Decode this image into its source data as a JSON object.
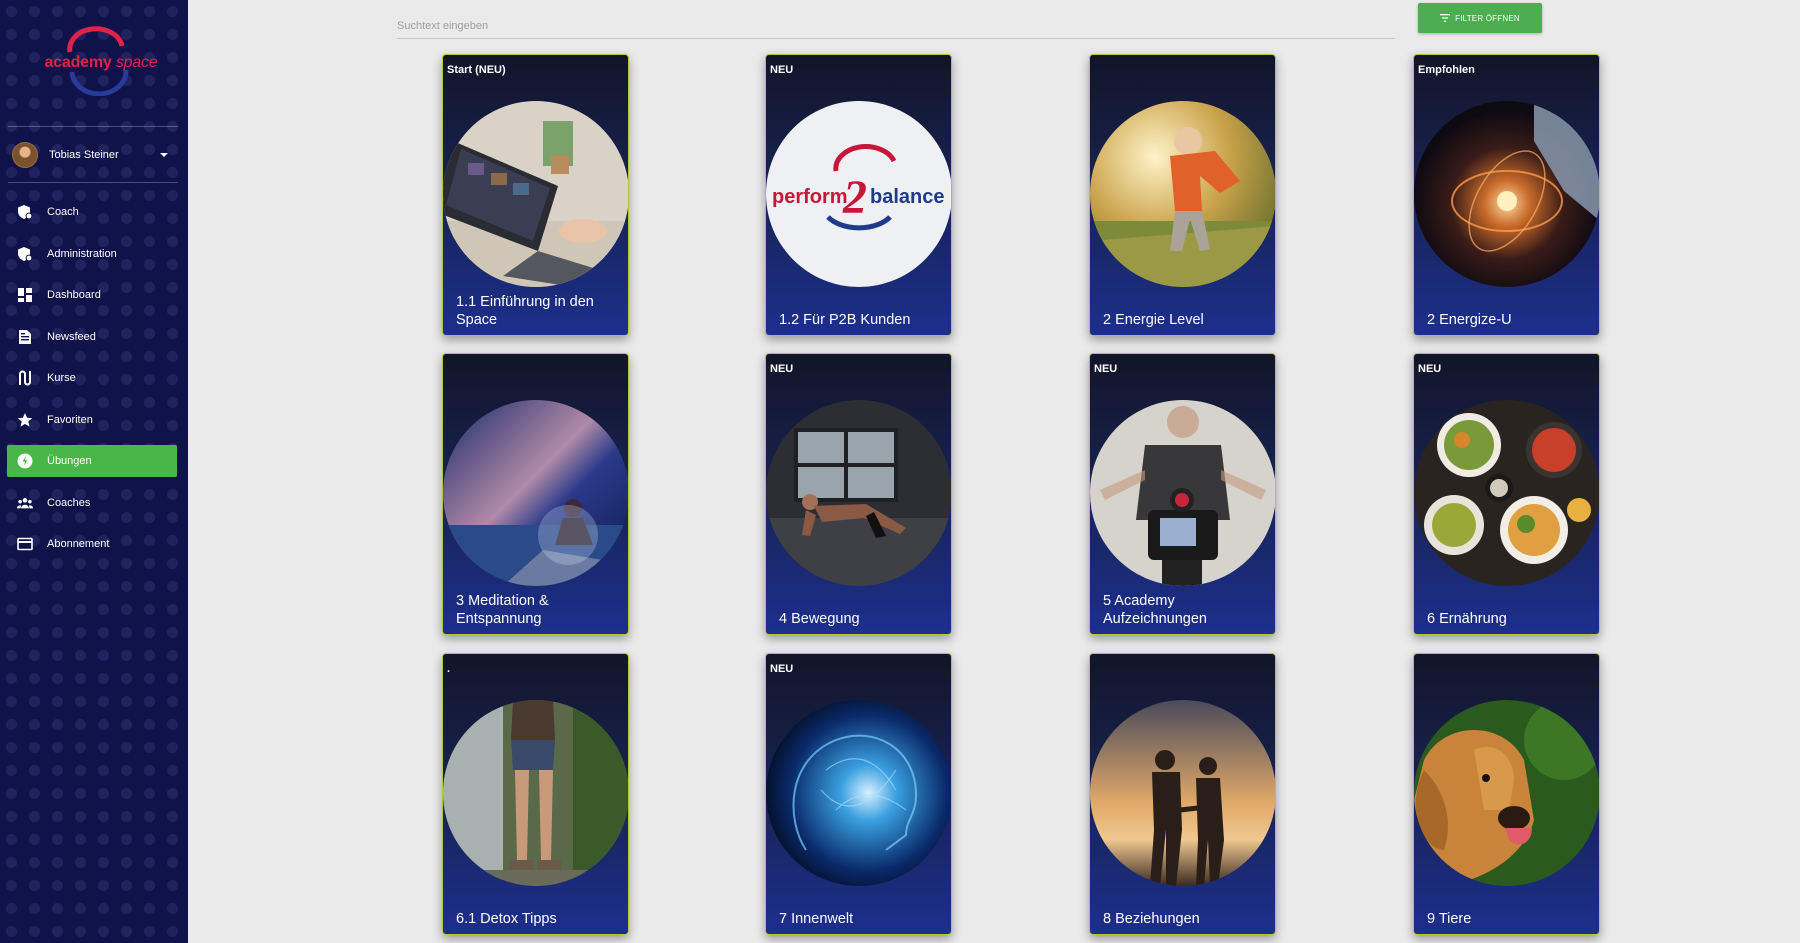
{
  "brand": {
    "logo_word1": "academy",
    "logo_word2": "space"
  },
  "user": {
    "name": "Tobias Steiner"
  },
  "sidebar": {
    "items": [
      {
        "label": "Coach",
        "icon": "shield-user-icon",
        "active": false
      },
      {
        "label": "Administration",
        "icon": "shield-user-icon",
        "active": false
      },
      {
        "label": "Dashboard",
        "icon": "dashboard-icon",
        "active": false
      },
      {
        "label": "Newsfeed",
        "icon": "article-icon",
        "active": false
      },
      {
        "label": "Kurse",
        "icon": "route-icon",
        "active": false
      },
      {
        "label": "Favoriten",
        "icon": "star-icon",
        "active": false
      },
      {
        "label": "Übungen",
        "icon": "exercise-icon",
        "active": true
      },
      {
        "label": "Coaches",
        "icon": "group-icon",
        "active": false
      },
      {
        "label": "Abonnement",
        "icon": "credit-card-icon",
        "active": false
      }
    ]
  },
  "search": {
    "placeholder": "Suchtext eingeben",
    "value": ""
  },
  "filter": {
    "label": "FILTER ÖFFNEN",
    "icon": "filter-icon"
  },
  "colors": {
    "sidebar_bg": "#10124a",
    "accent_green": "#4cae50",
    "logo_red": "#e0224a",
    "logo_blue": "#2a3a9a",
    "card_border": "#b9c23a"
  },
  "cards": [
    {
      "badge": "Start (NEU)",
      "title": "1.1 Einführung in den Space",
      "image": "laptop-on-desk-image"
    },
    {
      "badge": "NEU",
      "title": "1.2 Für P2B Kunden",
      "image": "perform2balance-logo-image",
      "logo_text_1": "perform",
      "logo_text_2": "2",
      "logo_text_3": "balance"
    },
    {
      "badge": "",
      "title": "2 Energie Level",
      "image": "woman-jumping-in-field-image"
    },
    {
      "badge": "Empfohlen",
      "title": "2 Energize-U",
      "image": "energy-orb-hands-image"
    },
    {
      "badge": "",
      "title": "3 Meditation & Entspannung",
      "image": "meditation-under-galaxy-image"
    },
    {
      "badge": "NEU",
      "title": "4 Bewegung",
      "image": "man-exercising-image"
    },
    {
      "badge": "NEU",
      "title": "5 Academy Aufzeichnungen",
      "image": "camera-recording-image"
    },
    {
      "badge": "NEU",
      "title": "6 Ernährung",
      "image": "healthy-food-bowls-image"
    },
    {
      "badge": ".",
      "title": "6.1 Detox Tipps",
      "image": "hiker-legs-waterfall-image"
    },
    {
      "badge": "NEU",
      "title": "7 Innenwelt",
      "image": "neural-head-image"
    },
    {
      "badge": "",
      "title": "8 Beziehungen",
      "image": "couple-sunset-image"
    },
    {
      "badge": "",
      "title": "9 Tiere",
      "image": "golden-retriever-image"
    }
  ]
}
